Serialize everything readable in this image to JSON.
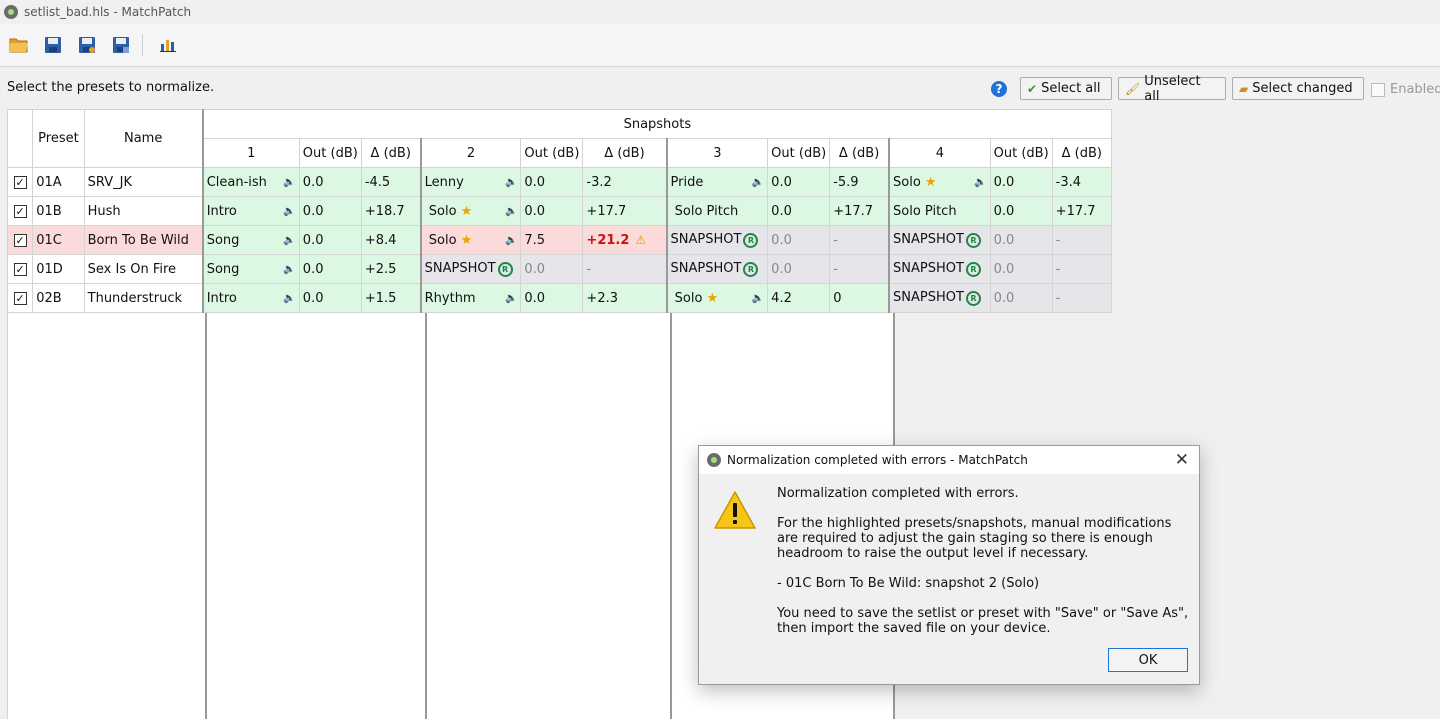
{
  "window": {
    "title": "setlist_bad.hls - MatchPatch"
  },
  "toolbar": {
    "icons": [
      "open-folder-icon",
      "save-icon",
      "save-as-icon",
      "save-all-icon",
      "stats-chart-icon"
    ]
  },
  "prompt": "Select the presets to normalize.",
  "buttons": {
    "help": "?",
    "select_all": "Select all",
    "unselect_all": "Unselect all",
    "select_changed": "Select changed",
    "enabled": "Enabled"
  },
  "grid": {
    "headers": {
      "preset": "Preset",
      "name": "Name",
      "snapshots": "Snapshots",
      "out": "Out (dB)",
      "delta": "Δ (dB)",
      "snap_numbers": [
        "1",
        "2",
        "3",
        "4"
      ]
    },
    "rows": [
      {
        "checked": "✓",
        "preset": "01A",
        "name": "SRV_JK",
        "state": "normal",
        "snaps": [
          {
            "name": "Clean-ish",
            "star": false,
            "speaker": true,
            "out": "0.0",
            "delta": "-4.5",
            "style": "green"
          },
          {
            "name": "Lenny",
            "star": false,
            "speaker": true,
            "out": "0.0",
            "delta": "-3.2",
            "style": "green"
          },
          {
            "name": "Pride",
            "star": false,
            "speaker": true,
            "out": "0.0",
            "delta": "-5.9",
            "style": "green"
          },
          {
            "name": "Solo",
            "star": true,
            "speaker": true,
            "out": "0.0",
            "delta": "-3.4",
            "style": "green"
          }
        ]
      },
      {
        "checked": "✓",
        "preset": "01B",
        "name": "Hush",
        "state": "normal",
        "snaps": [
          {
            "name": "Intro",
            "star": false,
            "speaker": true,
            "out": "0.0",
            "delta": "+18.7",
            "style": "green"
          },
          {
            "name": " Solo",
            "star": true,
            "speaker": true,
            "out": "0.0",
            "delta": "+17.7",
            "style": "green"
          },
          {
            "name": " Solo Pitch",
            "star": false,
            "speaker": false,
            "out": "0.0",
            "delta": "+17.7",
            "style": "green"
          },
          {
            "name": "Solo Pitch",
            "star": false,
            "speaker": false,
            "out": "0.0",
            "delta": "+17.7",
            "style": "green"
          }
        ]
      },
      {
        "checked": "✓",
        "preset": "01C",
        "name": "Born To Be Wild",
        "state": "error",
        "snaps": [
          {
            "name": "Song",
            "star": false,
            "speaker": true,
            "out": "0.0",
            "delta": "+8.4",
            "style": "green"
          },
          {
            "name": " Solo",
            "star": true,
            "speaker": true,
            "out": "7.5",
            "delta": "+21.2",
            "style": "red",
            "warn": true
          },
          {
            "name": "SNAPSHOT",
            "star": false,
            "speaker": false,
            "out": "0.0",
            "delta": "-",
            "style": "gray",
            "disabled": true
          },
          {
            "name": "SNAPSHOT",
            "star": false,
            "speaker": false,
            "out": "0.0",
            "delta": "-",
            "style": "gray",
            "disabled": true
          }
        ]
      },
      {
        "checked": "✓",
        "preset": "01D",
        "name": "Sex Is On Fire",
        "state": "normal",
        "snaps": [
          {
            "name": "Song",
            "star": false,
            "speaker": true,
            "out": "0.0",
            "delta": "+2.5",
            "style": "green"
          },
          {
            "name": "SNAPSHOT",
            "star": false,
            "speaker": false,
            "out": "0.0",
            "delta": "-",
            "style": "gray",
            "disabled": true
          },
          {
            "name": "SNAPSHOT",
            "star": false,
            "speaker": false,
            "out": "0.0",
            "delta": "-",
            "style": "gray",
            "disabled": true
          },
          {
            "name": "SNAPSHOT",
            "star": false,
            "speaker": false,
            "out": "0.0",
            "delta": "-",
            "style": "gray",
            "disabled": true
          }
        ]
      },
      {
        "checked": "✓",
        "preset": "02B",
        "name": "Thunderstruck",
        "state": "normal",
        "snaps": [
          {
            "name": "Intro",
            "star": false,
            "speaker": true,
            "out": "0.0",
            "delta": "+1.5",
            "style": "green"
          },
          {
            "name": "Rhythm",
            "star": false,
            "speaker": true,
            "out": "0.0",
            "delta": "+2.3",
            "style": "green"
          },
          {
            "name": " Solo",
            "star": true,
            "speaker": true,
            "out": "4.2",
            "delta": "0",
            "style": "green"
          },
          {
            "name": "SNAPSHOT",
            "star": false,
            "speaker": false,
            "out": "0.0",
            "delta": "-",
            "style": "gray",
            "disabled": true
          }
        ]
      }
    ]
  },
  "dialog": {
    "title": "Normalization completed with errors - MatchPatch",
    "heading": "Normalization completed with errors.",
    "para1": "For the highlighted presets/snapshots, manual modifications are required to adjust the gain staging so there is enough headroom to raise the output level if necessary.",
    "item": "- 01C Born To Be Wild: snapshot 2 (Solo)",
    "para2": "You need to save the setlist or preset with \"Save\" or \"Save As\", then import the saved file on your device.",
    "ok": "OK",
    "close": "✕"
  },
  "colors": {
    "green_cell": "#dcf7e2",
    "red_cell": "#fbdada",
    "gray_cell": "#e6e6ea",
    "error_text": "#cc1111",
    "accent": "#1e72d8"
  }
}
